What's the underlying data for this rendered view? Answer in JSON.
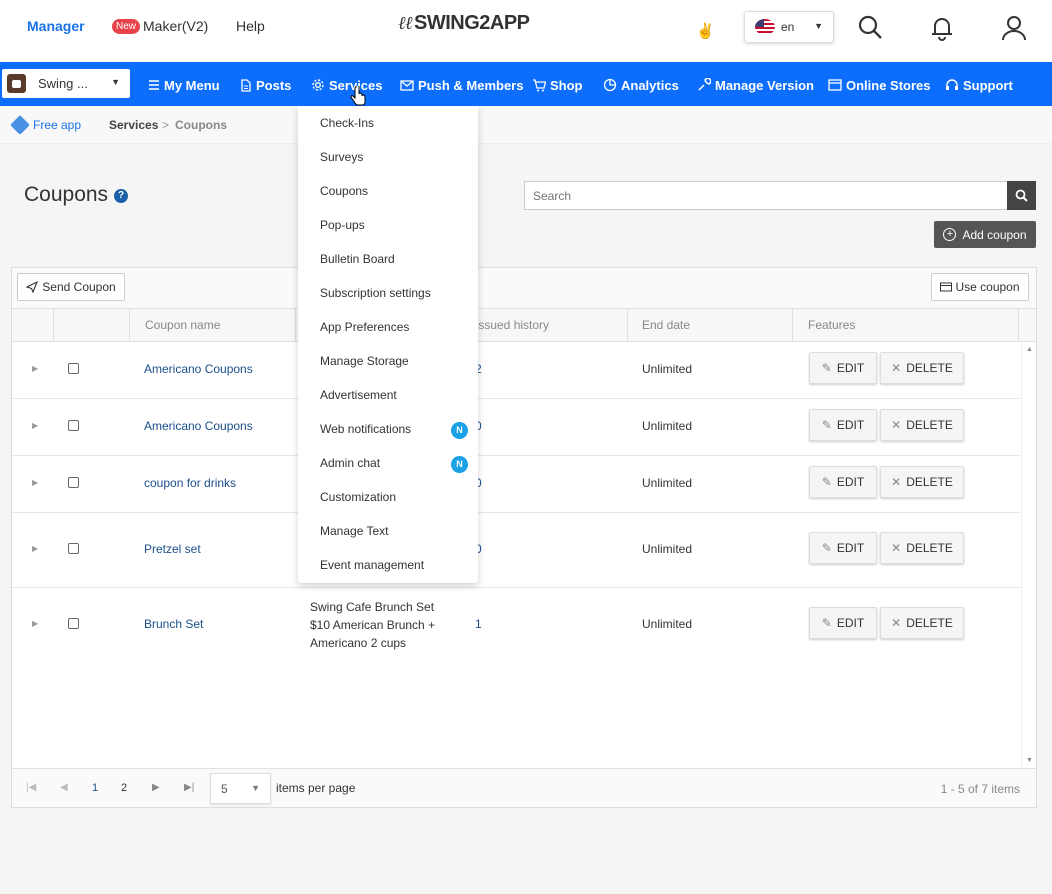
{
  "header": {
    "manager": "Manager",
    "new_badge": "New",
    "maker": "Maker(V2)",
    "help": "Help",
    "logo": "SWING2APP",
    "logo_mark": "ℓℓ",
    "language": "en",
    "icons": [
      "search-icon",
      "bell-icon",
      "user-icon"
    ]
  },
  "nav": {
    "app_name": "Swing ...",
    "items": [
      "My Menu",
      "Posts",
      "Services",
      "Push & Members",
      "Shop",
      "Analytics",
      "Manage Version",
      "Online Stores",
      "Support"
    ]
  },
  "breadcrumb": {
    "app": "Free app",
    "section": "Services",
    "separator": ">",
    "current": "Coupons"
  },
  "page": {
    "title": "Coupons",
    "help": "?",
    "search_placeholder": "Search",
    "add_coupon": "Add coupon"
  },
  "grid": {
    "send_coupon": "Send Coupon",
    "use_coupon": "Use coupon",
    "columns": [
      "Coupon name",
      "Issued history",
      "End date",
      "Features"
    ],
    "edit_label": "EDIT",
    "delete_label": "DELETE",
    "rows": [
      {
        "name": "Americano Coupons",
        "history": "2",
        "end": "Unlimited"
      },
      {
        "name": "Americano Coupons",
        "history": "0",
        "end": "Unlimited"
      },
      {
        "name": "coupon for drinks",
        "history": "0",
        "end": "Unlimited"
      },
      {
        "name": "Pretzel set",
        "history": "0",
        "end": "Unlimited"
      },
      {
        "name": "Brunch Set",
        "history": "1",
        "end": "Unlimited",
        "desc": [
          "Swing Cafe Brunch Set",
          "$10 American Brunch +",
          "Americano 2 cups"
        ]
      }
    ],
    "pager": {
      "pages": [
        "1",
        "2"
      ],
      "per_page": "5",
      "per_page_label": "items per page",
      "range": "1 - 5 of 7 items"
    }
  },
  "services_menu": {
    "items": [
      "Check-Ins",
      "Surveys",
      "Coupons",
      "Pop-ups",
      "Bulletin Board",
      "Subscription settings",
      "App Preferences",
      "Manage Storage",
      "Advertisement",
      "Web notifications",
      "Admin chat",
      "Customization",
      "Manage Text",
      "Event management"
    ],
    "badge": "N"
  },
  "colors": {
    "nav_bg": "#0d6efd",
    "link": "#1a4f8b",
    "badge_new": "#e8424a",
    "badge_n": "#1aa1e6"
  }
}
